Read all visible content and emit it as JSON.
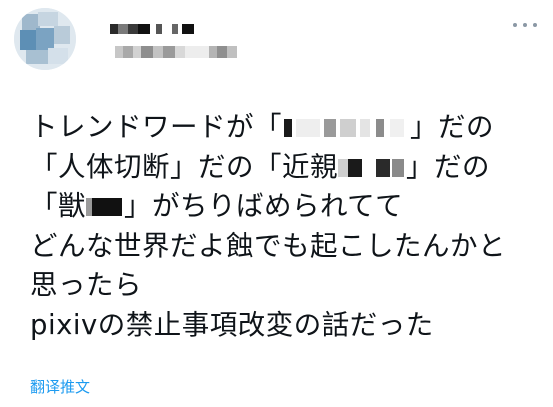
{
  "tweet": {
    "lines": {
      "l1_before": "トレンドワードが「",
      "l1_after": "」だの",
      "l2_before": "「人体切断」だの「近親",
      "l2_after": "」だの",
      "l3_before": "「獣",
      "l3_after": "」がちりばめられてて",
      "l4": "どんな世界だよ蝕でも起こしたんかと",
      "l5": "思ったら",
      "l6": "pixivの禁止事項改変の話だった"
    },
    "translate_label": "翻译推文"
  },
  "colors": {
    "text": "#0f1419",
    "link": "#1d9bf0",
    "muted": "#8b98a5"
  },
  "icons": {
    "more": "more-horizontal-icon"
  }
}
